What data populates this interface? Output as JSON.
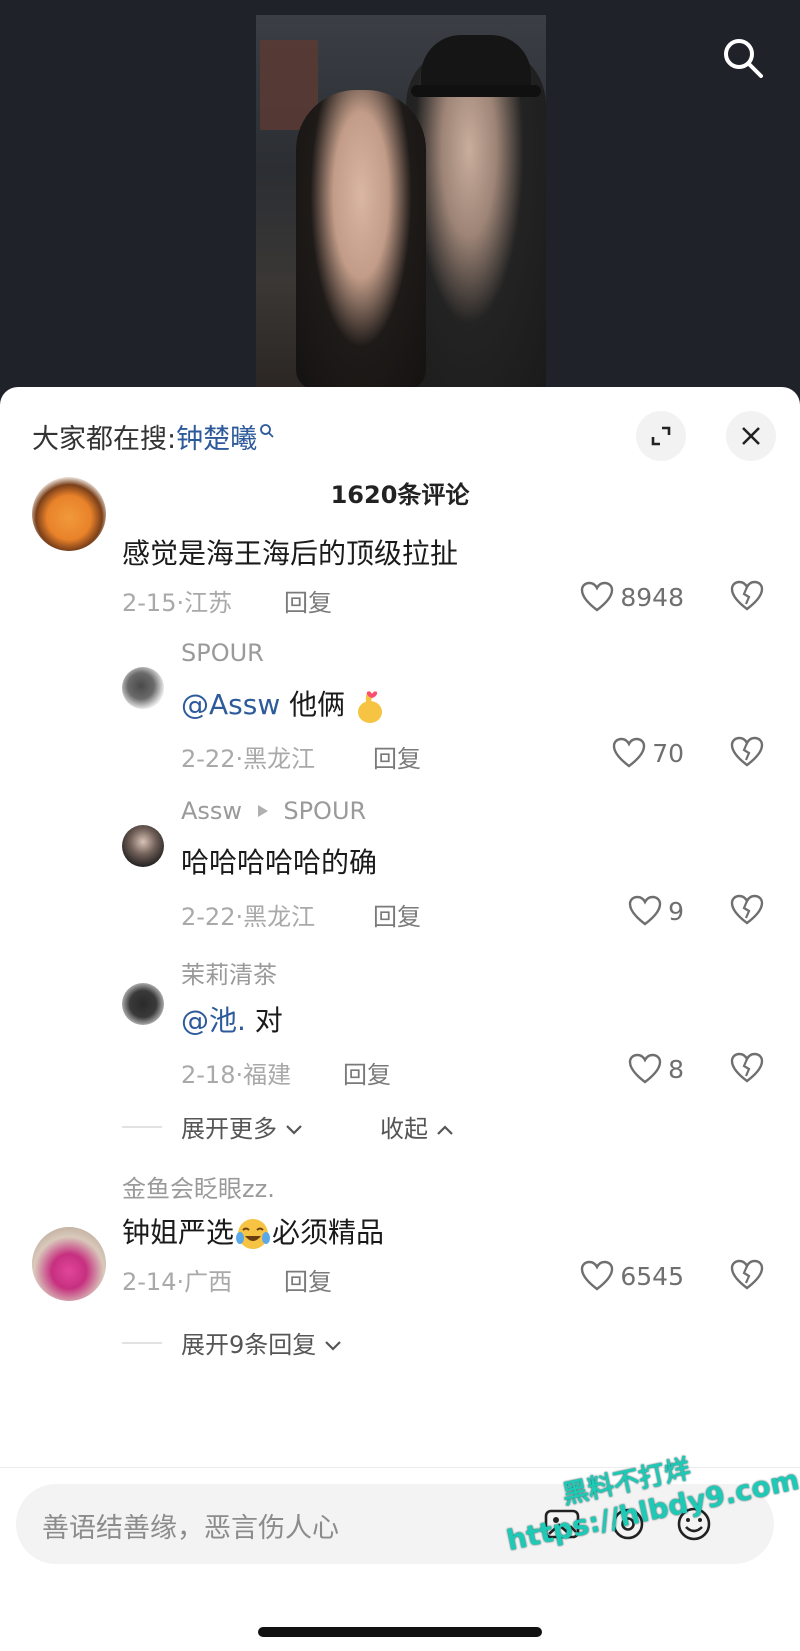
{
  "header": {
    "search_icon": "search-icon"
  },
  "sheet": {
    "hot_search_label": "大家都在搜:",
    "hot_search_keyword": "钟楚曦",
    "comment_count": "1620条评论"
  },
  "comments": [
    {
      "text": "感觉是海王海后的顶级拉扯",
      "meta": "2-15·江苏",
      "reply": "回复",
      "likes": "8948"
    },
    {
      "name": "SPOUR",
      "at": "@Assw",
      "text": " 他俩 ",
      "meta": "2-22·黑龙江",
      "reply": "回复",
      "likes": "70"
    },
    {
      "name": "Assw",
      "reply_to": "SPOUR",
      "text": "哈哈哈哈哈的确",
      "meta": "2-22·黑龙江",
      "reply": "回复",
      "likes": "9"
    },
    {
      "name": "茉莉清茶",
      "at": "@池.",
      "text": " 对",
      "meta": "2-18·福建",
      "reply": "回复",
      "likes": "8"
    },
    {
      "name": "金鱼会眨眼zz.",
      "text_before": "钟姐严选",
      "text_after": "必须精品",
      "meta": "2-14·广西",
      "reply": "回复",
      "likes": "6545"
    }
  ],
  "thread_controls": {
    "expand_more": "展开更多",
    "collapse": "收起"
  },
  "expand_replies": "展开9条回复",
  "input": {
    "placeholder": "善语结善缘，恶言伤人心"
  },
  "watermark": {
    "line1": "黑料不打烊",
    "line2": "https://hlbdy9.com"
  },
  "colors": {
    "link": "#2d5a9a",
    "watermark": "#1ec9b6"
  }
}
